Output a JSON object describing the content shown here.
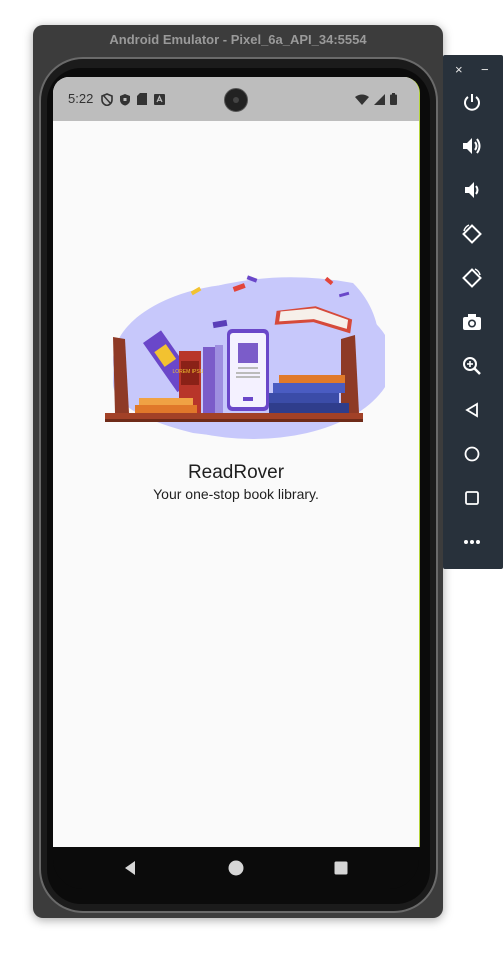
{
  "window": {
    "title": "Android Emulator - Pixel_6a_API_34:5554"
  },
  "status_bar": {
    "time": "5:22",
    "left_icons": [
      "privacy-shield-icon",
      "shield-icon",
      "sd-card-icon",
      "app-notification-icon"
    ],
    "right_icons": [
      "wifi-icon",
      "signal-icon",
      "battery-icon"
    ]
  },
  "app": {
    "title": "ReadRover",
    "subtitle": "Your one-stop book library."
  },
  "illustration": {
    "book_cover_text": "LOREM IPSUM",
    "blob_color": "#c7c8fb",
    "shelf_color": "#8e3a26"
  },
  "nav_bar": {
    "buttons": [
      "back-icon",
      "home-icon",
      "recents-icon"
    ]
  },
  "toolbar": {
    "close_label": "×",
    "minimize_label": "−",
    "buttons": [
      "power-icon",
      "volume-up-icon",
      "volume-down-icon",
      "rotate-left-icon",
      "rotate-right-icon",
      "camera-icon",
      "zoom-icon",
      "back-icon",
      "home-icon",
      "overview-icon",
      "more-icon"
    ]
  }
}
